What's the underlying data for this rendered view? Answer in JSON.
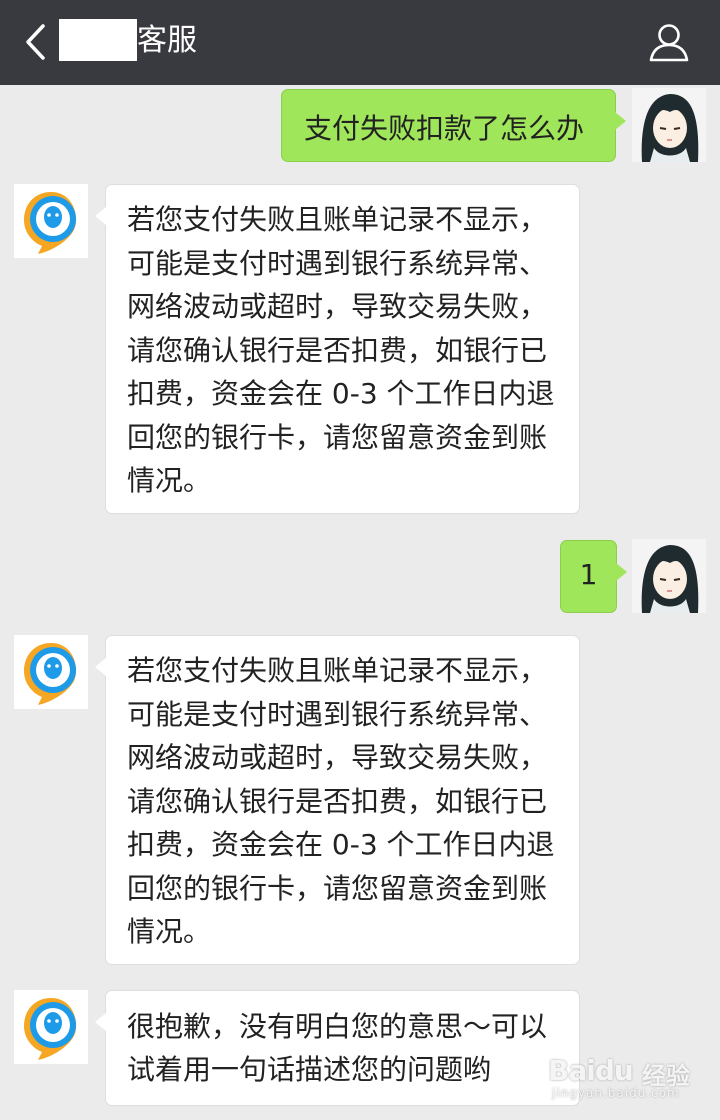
{
  "header": {
    "title": "客服",
    "back_icon": "chevron-left-icon",
    "profile_icon": "person-icon"
  },
  "colors": {
    "header_bg": "#393a3f",
    "chat_bg": "#ebebeb",
    "user_bubble": "#9fe65a",
    "service_bubble": "#ffffff"
  },
  "messages": [
    {
      "sender": "user",
      "text": "支付失败扣款了怎么办"
    },
    {
      "sender": "service",
      "text": "若您支付失败且账单记录不显示，可能是支付时遇到银行系统异常、网络波动或超时，导致交易失败，请您确认银行是否扣费，如银行已扣费，资金会在 0-3 个工作日内退回您的银行卡，请您留意资金到账情况。"
    },
    {
      "sender": "user",
      "text": "1"
    },
    {
      "sender": "service",
      "text": "若您支付失败且账单记录不显示，可能是支付时遇到银行系统异常、网络波动或超时，导致交易失败，请您确认银行是否扣费，如银行已扣费，资金会在 0-3 个工作日内退回您的银行卡，请您留意资金到账情况。"
    },
    {
      "sender": "service",
      "text": "很抱歉，没有明白您的意思～可以试着用一句话描述您的问题哟"
    }
  ],
  "watermark": {
    "logo": "Baidu",
    "text": "经验",
    "sub": "jingyan.baidu.com"
  }
}
